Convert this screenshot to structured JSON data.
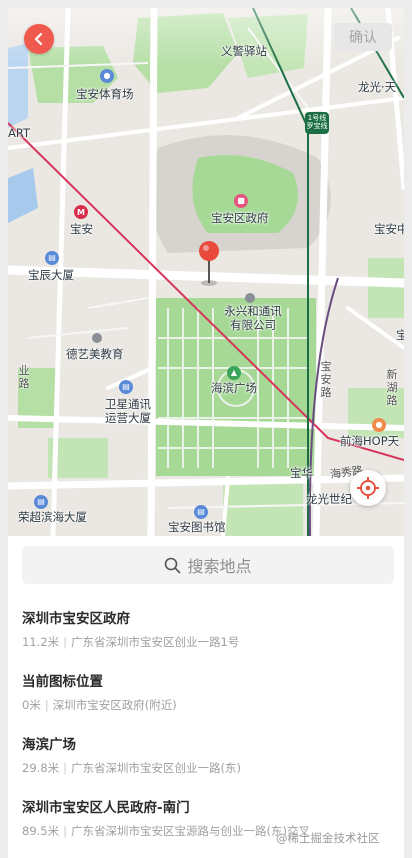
{
  "header": {
    "confirm_label": "确认"
  },
  "map": {
    "labels": {
      "yijing_station": "义警驿站",
      "baoan_stadium": "宝安体育场",
      "longguang_tianxia": "龙光·天",
      "art": "ART",
      "baoan_district_gov": "宝安区政府",
      "baoan": "宝安",
      "baoan_center": "宝安中",
      "baochen_building": "宝辰大厦",
      "yongxinghe": "永兴和通讯\n有限公司",
      "deyi_school": "德艺美教育",
      "haibin_square": "海滨广场",
      "weixing_tongxun": "卫星通讯\n运营大厦",
      "qianhai_hop": "前海HOP天",
      "baohua": "宝华",
      "longguang_shiji": "龙光世纪",
      "rongchao_binhai": "荣超滨海大厦",
      "baoan_library": "宝安图书馆",
      "baocheng": "宝城"
    },
    "roads": {
      "yeye_road": "业路",
      "baoan_road": "宝安路",
      "xinhu_road": "新湖路",
      "haixiu_road": "海秀路"
    },
    "metro_line_badge": "1号线\n罗宝线",
    "icons": {
      "back": "chevron-left-icon",
      "locate": "crosshair-icon",
      "pin": "map-pin-icon"
    },
    "colors": {
      "back_button": "#f05a4e",
      "pin": "#e84a3c",
      "locate": "#e8533f",
      "park": "#a6d996",
      "metro_line": "#d7325a"
    }
  },
  "search": {
    "placeholder": "搜索地点",
    "icon": "search-icon"
  },
  "results": [
    {
      "name": "深圳市宝安区政府",
      "distance": "11.2米",
      "address": "广东省深圳市宝安区创业一路1号"
    },
    {
      "name": "当前图标位置",
      "distance": "0米",
      "address": "深圳市宝安区政府(附近)"
    },
    {
      "name": "海滨广场",
      "distance": "29.8米",
      "address": "广东省深圳市宝安区创业一路(东)"
    },
    {
      "name": "深圳市宝安区人民政府-南门",
      "distance": "89.5米",
      "address": "广东省深圳市宝安区宝源路与创业一路(东)交叉"
    }
  ],
  "watermark": "@稀土掘金技术社区"
}
